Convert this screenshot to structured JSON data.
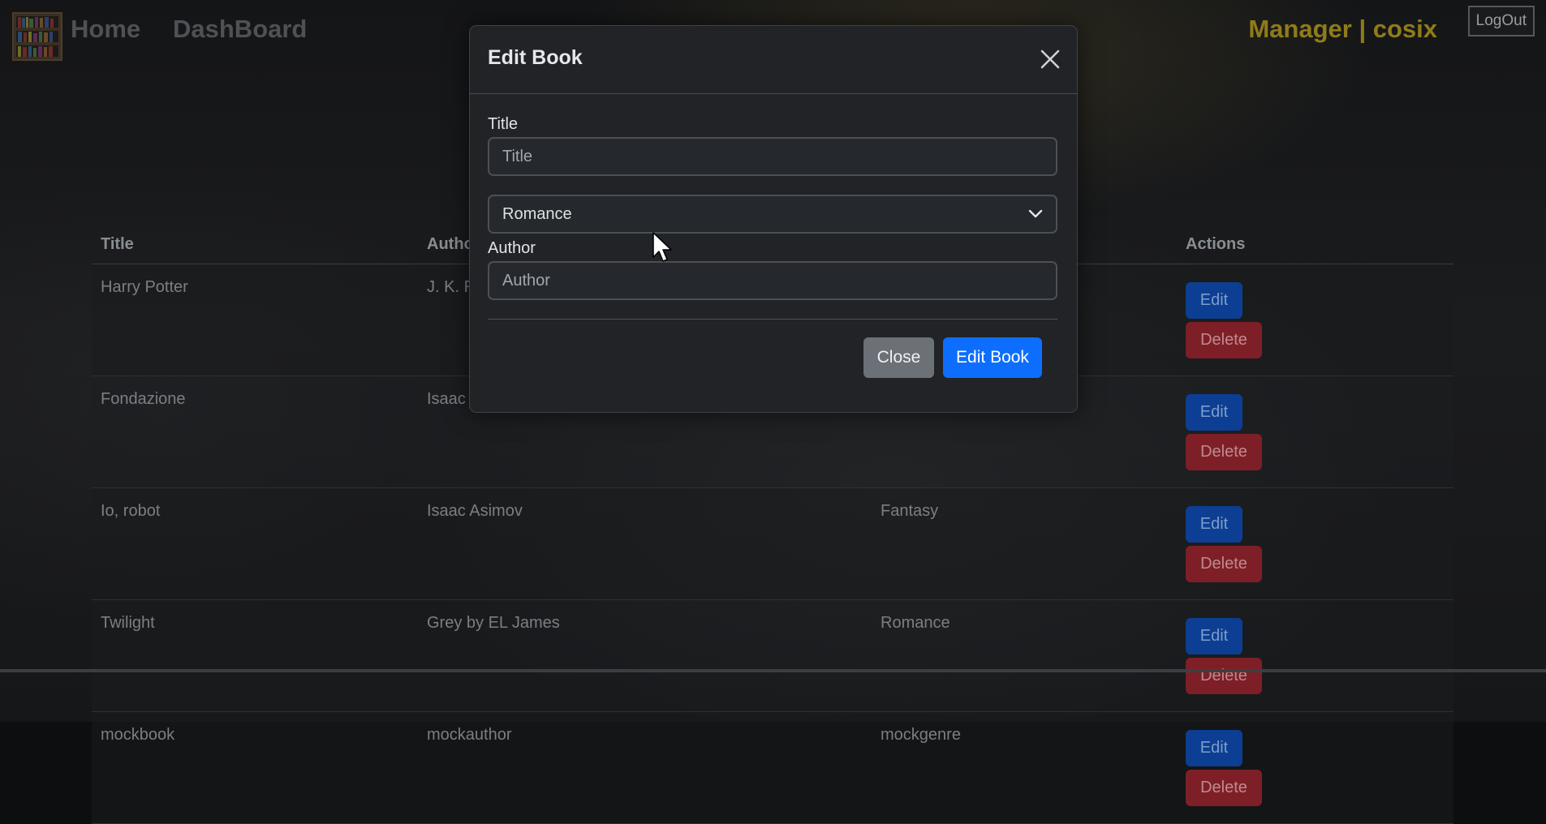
{
  "nav": {
    "home": "Home",
    "dashboard": "DashBoard",
    "user": "Manager | cosix",
    "logout": "LogOut",
    "logo_icon": "bookshelf-logo-icon"
  },
  "table": {
    "headers": {
      "title": "Title",
      "author": "Author",
      "genre": "",
      "actions": "Actions"
    },
    "rows": [
      {
        "title": "Harry Potter",
        "author": "J. K. R",
        "genre": ""
      },
      {
        "title": "Fondazione",
        "author": "Isaac",
        "genre": ""
      },
      {
        "title": "Io, robot",
        "author": "Isaac Asimov",
        "genre": "Fantasy"
      },
      {
        "title": "Twilight",
        "author": "Grey by EL James",
        "genre": "Romance"
      },
      {
        "title": "mockbook",
        "author": "mockauthor",
        "genre": "mockgenre"
      }
    ],
    "edit_label": "Edit",
    "delete_label": "Delete"
  },
  "modal": {
    "title": "Edit Book",
    "title_label": "Title",
    "title_placeholder": "Title",
    "genre_selected": "Romance",
    "author_label": "Author",
    "author_placeholder": "Author",
    "close_button": "Close",
    "submit_button": "Edit Book"
  },
  "colors": {
    "primary": "#0d6efd",
    "secondary": "#6b7177",
    "manager_accent": "#8f7b1a",
    "danger": "#7e1f27"
  }
}
